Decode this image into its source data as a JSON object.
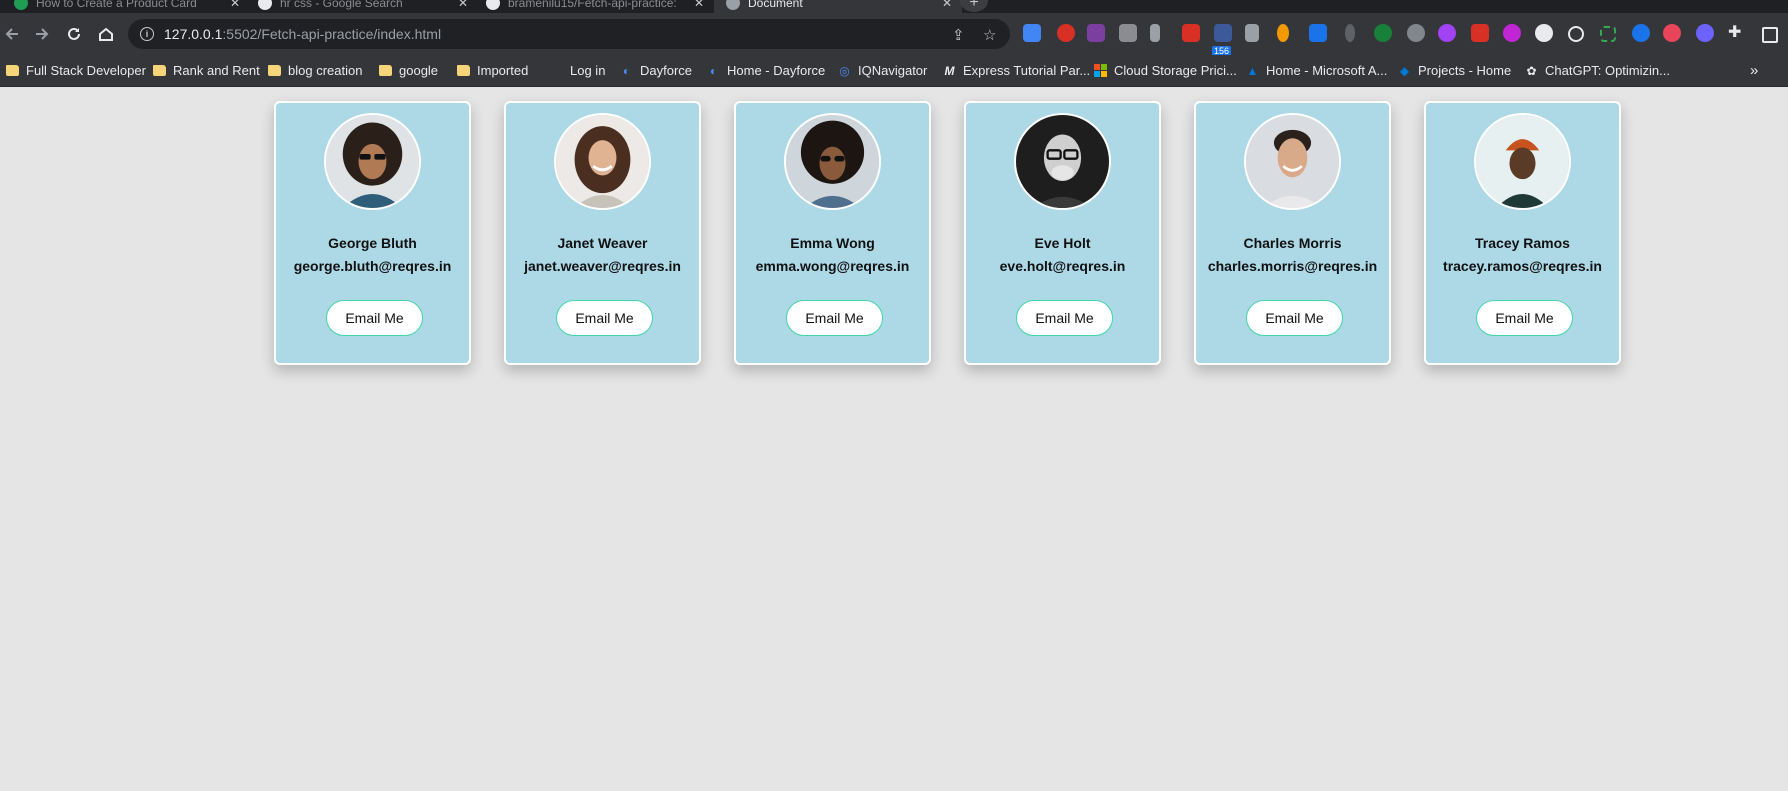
{
  "browser": {
    "tabs": [
      {
        "title": "How to Create a Product Card",
        "active": false,
        "favicon_color": "#1f9d55"
      },
      {
        "title": "hr css - Google Search",
        "active": false,
        "favicon_color": "#e8eaed"
      },
      {
        "title": "bramenilu15/Fetch-api-practice:",
        "active": false,
        "favicon_color": "#e8eaed"
      },
      {
        "title": "Document",
        "active": true,
        "favicon_color": "#9aa0a6"
      }
    ],
    "address_bar": {
      "host": "127.0.0.1",
      "rest": ":5502/Fetch-api-practice/index.html"
    },
    "extension_badge": "156",
    "bookmarks": [
      {
        "label": "Full Stack Developer",
        "icon": "folder-icon"
      },
      {
        "label": "Rank and Rent",
        "icon": "folder-icon"
      },
      {
        "label": "blog creation",
        "icon": "folder-icon"
      },
      {
        "label": "google",
        "icon": "folder-icon"
      },
      {
        "label": "Imported",
        "icon": "folder-icon"
      },
      {
        "label": "Log in",
        "icon": "none"
      },
      {
        "label": "Dayforce",
        "icon": "dayforce-icon"
      },
      {
        "label": "Home - Dayforce",
        "icon": "dayforce-icon"
      },
      {
        "label": "IQNavigator",
        "icon": "iqnavigator-icon"
      },
      {
        "label": "Express Tutorial Par...",
        "icon": "mdn-icon"
      },
      {
        "label": "Cloud Storage Prici...",
        "icon": "microsoft-icon"
      },
      {
        "label": "Home - Microsoft A...",
        "icon": "azure-icon"
      },
      {
        "label": "Projects - Home",
        "icon": "azure-devops-icon"
      },
      {
        "label": "ChatGPT: Optimizin...",
        "icon": "chatgpt-icon"
      }
    ],
    "more_bookmarks": "»"
  },
  "users": [
    {
      "name": "George Bluth",
      "email": "george.bluth@reqres.in",
      "button": "Email Me"
    },
    {
      "name": "Janet Weaver",
      "email": "janet.weaver@reqres.in",
      "button": "Email Me"
    },
    {
      "name": "Emma Wong",
      "email": "emma.wong@reqres.in",
      "button": "Email Me"
    },
    {
      "name": "Eve Holt",
      "email": "eve.holt@reqres.in",
      "button": "Email Me"
    },
    {
      "name": "Charles Morris",
      "email": "charles.morris@reqres.in",
      "button": "Email Me"
    },
    {
      "name": "Tracey Ramos",
      "email": "tracey.ramos@reqres.in",
      "button": "Email Me"
    }
  ],
  "colors": {
    "page_background": "#e5e5e5",
    "card_background": "#add8e6",
    "button_border": "#41d6a8"
  }
}
